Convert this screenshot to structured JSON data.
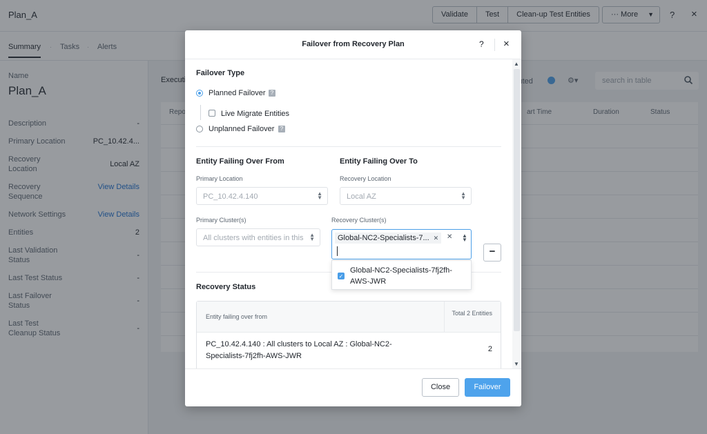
{
  "page": {
    "title": "Plan_A",
    "actions": [
      "Validate",
      "Test",
      "Clean-up Test Entities"
    ],
    "more_label": "··· More",
    "help": "?",
    "close": "×"
  },
  "tabs": [
    "Summary",
    "Tasks",
    "Alerts"
  ],
  "summary": {
    "name_label": "Name",
    "name_value": "Plan_A",
    "rows": [
      {
        "label": "Description",
        "value": "-"
      },
      {
        "label": "Primary Location",
        "value": "PC_10.42.4..."
      },
      {
        "label": "Recovery Location",
        "value": "Local AZ"
      },
      {
        "label": "Recovery Sequence",
        "value": "View Details"
      },
      {
        "label": "Network Settings",
        "value": "View Details"
      },
      {
        "label": "Entities",
        "value": "2"
      },
      {
        "label": "Last Validation Status",
        "value": "-"
      },
      {
        "label": "Last Test Status",
        "value": "-"
      },
      {
        "label": "Last Failover Status",
        "value": "-"
      },
      {
        "label": "Last Test Cleanup Status",
        "value": "-"
      }
    ]
  },
  "executions": {
    "label": "Executi",
    "right_label": "cuted",
    "search_placeholder": "search in table",
    "columns": [
      "Repo",
      "art Time",
      "Duration",
      "Status"
    ]
  },
  "modal": {
    "title": "Failover from Recovery Plan",
    "help": "?",
    "close": "×",
    "failover_type_title": "Failover Type",
    "planned_label": "Planned Failover",
    "live_migrate_label": "Live Migrate Entities",
    "unplanned_label": "Unplanned Failover",
    "help_badge": "?",
    "from_title": "Entity Failing Over From",
    "to_title": "Entity Failing Over To",
    "primary_location_label": "Primary Location",
    "primary_location_value": "PC_10.42.4.140",
    "recovery_location_label": "Recovery Location",
    "recovery_location_value": "Local AZ",
    "primary_cluster_label": "Primary Cluster(s)",
    "primary_cluster_value": "All clusters with entities in this",
    "recovery_cluster_label": "Recovery Cluster(s)",
    "recovery_cluster_chip": "Global-NC2-Specialists-7...",
    "recovery_cluster_option": "Global-NC2-Specialists-7fj2fh-AWS-JWR",
    "minus": "−",
    "recovery_status_title": "Recovery Status",
    "table_head_entity": "Entity failing over from",
    "table_head_total": "Total 2 Entities",
    "table_row_entity": "PC_10.42.4.140 : All clusters to Local AZ : Global-NC2-Specialists-7fj2fh-AWS-JWR",
    "table_row_count": "2",
    "close_button": "Close",
    "failover_button": "Failover"
  }
}
